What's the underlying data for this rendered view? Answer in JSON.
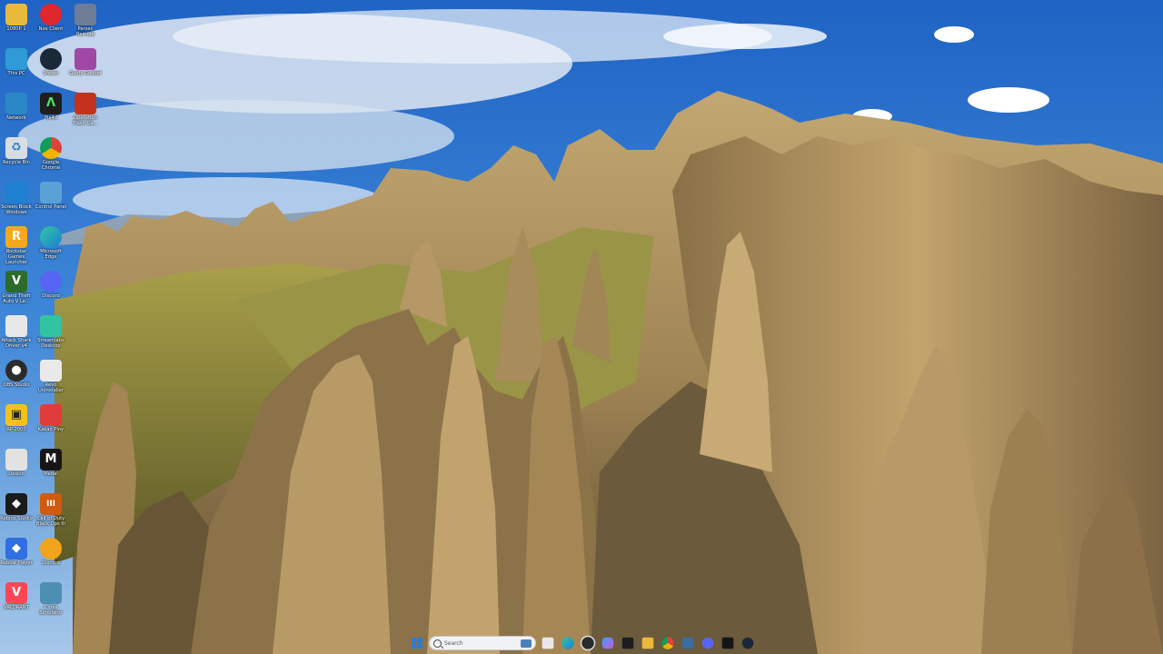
{
  "desktop": {
    "icons": [
      {
        "label": "1080P 1",
        "icon": "folder-icon",
        "color": "#e9b93c",
        "glyph": ""
      },
      {
        "label": "This PC",
        "icon": "computer-icon",
        "color": "#2f9ad6",
        "glyph": ""
      },
      {
        "label": "Network",
        "icon": "network-icon",
        "color": "#2b87c7",
        "glyph": ""
      },
      {
        "label": "Recycle Bin",
        "icon": "recycle-bin-icon",
        "color": "#d8dde3",
        "glyph": "♻"
      },
      {
        "label": "Screen Block Windows",
        "icon": "picture-icon",
        "color": "#1f7fd0",
        "glyph": ""
      },
      {
        "label": "Rockstar Games Launcher",
        "icon": "rockstar-icon",
        "color": "#f4a81c",
        "glyph": "R"
      },
      {
        "label": "Grand Theft Auto V Le...",
        "icon": "gta-icon",
        "color": "#2c6b2a",
        "glyph": "V"
      },
      {
        "label": "Attack Shark Driver v4",
        "icon": "shark-icon",
        "color": "#e7e7e7",
        "glyph": ""
      },
      {
        "label": "OBS Studio",
        "icon": "obs-icon",
        "color": "#2b2b2b",
        "glyph": "●"
      },
      {
        "label": "RP 2000",
        "icon": "robot-icon",
        "color": "#f2c21b",
        "glyph": "▣"
      },
      {
        "label": "Deskin",
        "icon": "rabbit-icon",
        "color": "#e2e2e2",
        "glyph": ""
      },
      {
        "label": "Roblox Studio",
        "icon": "roblox-studio-icon",
        "color": "#1b1b1b",
        "glyph": "◆"
      },
      {
        "label": "Roblox Player",
        "icon": "roblox-player-icon",
        "color": "#2f6fe0",
        "glyph": "◆"
      },
      {
        "label": "VALORANT",
        "icon": "valorant-icon",
        "color": "#ff4655",
        "glyph": "V"
      },
      {
        "label": "Nox Client",
        "icon": "nox-client-icon",
        "color": "#e0272b",
        "glyph": ""
      },
      {
        "label": "Steam",
        "icon": "steam-icon",
        "color": "#1b2838",
        "glyph": ""
      },
      {
        "label": "Pix4d",
        "icon": "pix-icon",
        "color": "#1e1e1e",
        "glyph": "Λ"
      },
      {
        "label": "Google Chrome",
        "icon": "chrome-icon",
        "color": "#e8e8e8",
        "glyph": ""
      },
      {
        "label": "Control Panel",
        "icon": "control-panel-icon",
        "color": "#5aa1d8",
        "glyph": ""
      },
      {
        "label": "Microsoft Edge",
        "icon": "edge-icon",
        "color": "#1c9ad6",
        "glyph": ""
      },
      {
        "label": "Discord",
        "icon": "discord-icon",
        "color": "#5865f2",
        "glyph": ""
      },
      {
        "label": "Streamlabs Desktop",
        "icon": "streamlabs-icon",
        "color": "#31c3a2",
        "glyph": ""
      },
      {
        "label": "Revo Uninstaller",
        "icon": "revo-icon",
        "color": "#e9e9e9",
        "glyph": ""
      },
      {
        "label": "Kakao Ploy",
        "icon": "app-icon",
        "color": "#e23b3b",
        "glyph": ""
      },
      {
        "label": "Medal",
        "icon": "medal-icon",
        "color": "#161616",
        "glyph": "M"
      },
      {
        "label": "Call of Duty Black Ops III",
        "icon": "cod-icon",
        "color": "#d05a10",
        "glyph": "III"
      },
      {
        "label": "Discord",
        "icon": "discord-icon",
        "color": "#f2a31c",
        "glyph": ""
      },
      {
        "label": "Cities Simulator",
        "icon": "cities-icon",
        "color": "#4d8fb3",
        "glyph": ""
      },
      {
        "label": "Parsec Remote",
        "icon": "parsec-icon",
        "color": "#6f7c96",
        "glyph": ""
      },
      {
        "label": "Goofy Goober",
        "icon": "goofy-icon",
        "color": "#a047a6",
        "glyph": ""
      },
      {
        "label": "Operation Flash Ga...",
        "icon": "operation-icon",
        "color": "#c4311c",
        "glyph": ""
      }
    ]
  },
  "taskbar": {
    "search_placeholder": "Search",
    "buttons": [
      {
        "name": "start-button",
        "icon": "windows-icon",
        "color": "#2b7bd6"
      },
      {
        "name": "file-button",
        "icon": "document-icon",
        "color": "#e9e9e9"
      },
      {
        "name": "edge-button",
        "icon": "edge-icon",
        "color": "#1c9ad6"
      },
      {
        "name": "obs-button",
        "icon": "obs-icon",
        "color": "#2b2b2b"
      },
      {
        "name": "copilot-button",
        "icon": "copilot-icon",
        "color": "#8a5cd6"
      },
      {
        "name": "pix-button",
        "icon": "pix-icon",
        "color": "#1e1e1e"
      },
      {
        "name": "explorer-button",
        "icon": "folder-icon",
        "color": "#e9b93c"
      },
      {
        "name": "chrome-button",
        "icon": "chrome-icon",
        "color": "#e8e8e8"
      },
      {
        "name": "settings-button",
        "icon": "gear-icon",
        "color": "#3d6d9e"
      },
      {
        "name": "discord-button",
        "icon": "discord-icon",
        "color": "#5865f2"
      },
      {
        "name": "medal-button",
        "icon": "medal-icon",
        "color": "#161616"
      },
      {
        "name": "steam-button",
        "icon": "steam-icon",
        "color": "#1b2838"
      }
    ]
  }
}
